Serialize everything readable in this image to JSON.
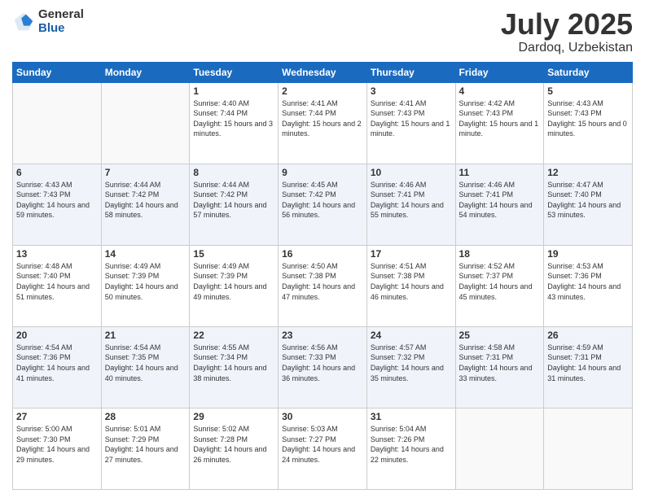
{
  "header": {
    "logo_general": "General",
    "logo_blue": "Blue",
    "month": "July 2025",
    "location": "Dardoq, Uzbekistan"
  },
  "days_of_week": [
    "Sunday",
    "Monday",
    "Tuesday",
    "Wednesday",
    "Thursday",
    "Friday",
    "Saturday"
  ],
  "weeks": [
    [
      {
        "day": "",
        "sunrise": "",
        "sunset": "",
        "daylight": ""
      },
      {
        "day": "",
        "sunrise": "",
        "sunset": "",
        "daylight": ""
      },
      {
        "day": "1",
        "sunrise": "Sunrise: 4:40 AM",
        "sunset": "Sunset: 7:44 PM",
        "daylight": "Daylight: 15 hours and 3 minutes."
      },
      {
        "day": "2",
        "sunrise": "Sunrise: 4:41 AM",
        "sunset": "Sunset: 7:44 PM",
        "daylight": "Daylight: 15 hours and 2 minutes."
      },
      {
        "day": "3",
        "sunrise": "Sunrise: 4:41 AM",
        "sunset": "Sunset: 7:43 PM",
        "daylight": "Daylight: 15 hours and 1 minute."
      },
      {
        "day": "4",
        "sunrise": "Sunrise: 4:42 AM",
        "sunset": "Sunset: 7:43 PM",
        "daylight": "Daylight: 15 hours and 1 minute."
      },
      {
        "day": "5",
        "sunrise": "Sunrise: 4:43 AM",
        "sunset": "Sunset: 7:43 PM",
        "daylight": "Daylight: 15 hours and 0 minutes."
      }
    ],
    [
      {
        "day": "6",
        "sunrise": "Sunrise: 4:43 AM",
        "sunset": "Sunset: 7:43 PM",
        "daylight": "Daylight: 14 hours and 59 minutes."
      },
      {
        "day": "7",
        "sunrise": "Sunrise: 4:44 AM",
        "sunset": "Sunset: 7:42 PM",
        "daylight": "Daylight: 14 hours and 58 minutes."
      },
      {
        "day": "8",
        "sunrise": "Sunrise: 4:44 AM",
        "sunset": "Sunset: 7:42 PM",
        "daylight": "Daylight: 14 hours and 57 minutes."
      },
      {
        "day": "9",
        "sunrise": "Sunrise: 4:45 AM",
        "sunset": "Sunset: 7:42 PM",
        "daylight": "Daylight: 14 hours and 56 minutes."
      },
      {
        "day": "10",
        "sunrise": "Sunrise: 4:46 AM",
        "sunset": "Sunset: 7:41 PM",
        "daylight": "Daylight: 14 hours and 55 minutes."
      },
      {
        "day": "11",
        "sunrise": "Sunrise: 4:46 AM",
        "sunset": "Sunset: 7:41 PM",
        "daylight": "Daylight: 14 hours and 54 minutes."
      },
      {
        "day": "12",
        "sunrise": "Sunrise: 4:47 AM",
        "sunset": "Sunset: 7:40 PM",
        "daylight": "Daylight: 14 hours and 53 minutes."
      }
    ],
    [
      {
        "day": "13",
        "sunrise": "Sunrise: 4:48 AM",
        "sunset": "Sunset: 7:40 PM",
        "daylight": "Daylight: 14 hours and 51 minutes."
      },
      {
        "day": "14",
        "sunrise": "Sunrise: 4:49 AM",
        "sunset": "Sunset: 7:39 PM",
        "daylight": "Daylight: 14 hours and 50 minutes."
      },
      {
        "day": "15",
        "sunrise": "Sunrise: 4:49 AM",
        "sunset": "Sunset: 7:39 PM",
        "daylight": "Daylight: 14 hours and 49 minutes."
      },
      {
        "day": "16",
        "sunrise": "Sunrise: 4:50 AM",
        "sunset": "Sunset: 7:38 PM",
        "daylight": "Daylight: 14 hours and 47 minutes."
      },
      {
        "day": "17",
        "sunrise": "Sunrise: 4:51 AM",
        "sunset": "Sunset: 7:38 PM",
        "daylight": "Daylight: 14 hours and 46 minutes."
      },
      {
        "day": "18",
        "sunrise": "Sunrise: 4:52 AM",
        "sunset": "Sunset: 7:37 PM",
        "daylight": "Daylight: 14 hours and 45 minutes."
      },
      {
        "day": "19",
        "sunrise": "Sunrise: 4:53 AM",
        "sunset": "Sunset: 7:36 PM",
        "daylight": "Daylight: 14 hours and 43 minutes."
      }
    ],
    [
      {
        "day": "20",
        "sunrise": "Sunrise: 4:54 AM",
        "sunset": "Sunset: 7:36 PM",
        "daylight": "Daylight: 14 hours and 41 minutes."
      },
      {
        "day": "21",
        "sunrise": "Sunrise: 4:54 AM",
        "sunset": "Sunset: 7:35 PM",
        "daylight": "Daylight: 14 hours and 40 minutes."
      },
      {
        "day": "22",
        "sunrise": "Sunrise: 4:55 AM",
        "sunset": "Sunset: 7:34 PM",
        "daylight": "Daylight: 14 hours and 38 minutes."
      },
      {
        "day": "23",
        "sunrise": "Sunrise: 4:56 AM",
        "sunset": "Sunset: 7:33 PM",
        "daylight": "Daylight: 14 hours and 36 minutes."
      },
      {
        "day": "24",
        "sunrise": "Sunrise: 4:57 AM",
        "sunset": "Sunset: 7:32 PM",
        "daylight": "Daylight: 14 hours and 35 minutes."
      },
      {
        "day": "25",
        "sunrise": "Sunrise: 4:58 AM",
        "sunset": "Sunset: 7:31 PM",
        "daylight": "Daylight: 14 hours and 33 minutes."
      },
      {
        "day": "26",
        "sunrise": "Sunrise: 4:59 AM",
        "sunset": "Sunset: 7:31 PM",
        "daylight": "Daylight: 14 hours and 31 minutes."
      }
    ],
    [
      {
        "day": "27",
        "sunrise": "Sunrise: 5:00 AM",
        "sunset": "Sunset: 7:30 PM",
        "daylight": "Daylight: 14 hours and 29 minutes."
      },
      {
        "day": "28",
        "sunrise": "Sunrise: 5:01 AM",
        "sunset": "Sunset: 7:29 PM",
        "daylight": "Daylight: 14 hours and 27 minutes."
      },
      {
        "day": "29",
        "sunrise": "Sunrise: 5:02 AM",
        "sunset": "Sunset: 7:28 PM",
        "daylight": "Daylight: 14 hours and 26 minutes."
      },
      {
        "day": "30",
        "sunrise": "Sunrise: 5:03 AM",
        "sunset": "Sunset: 7:27 PM",
        "daylight": "Daylight: 14 hours and 24 minutes."
      },
      {
        "day": "31",
        "sunrise": "Sunrise: 5:04 AM",
        "sunset": "Sunset: 7:26 PM",
        "daylight": "Daylight: 14 hours and 22 minutes."
      },
      {
        "day": "",
        "sunrise": "",
        "sunset": "",
        "daylight": ""
      },
      {
        "day": "",
        "sunrise": "",
        "sunset": "",
        "daylight": ""
      }
    ]
  ]
}
